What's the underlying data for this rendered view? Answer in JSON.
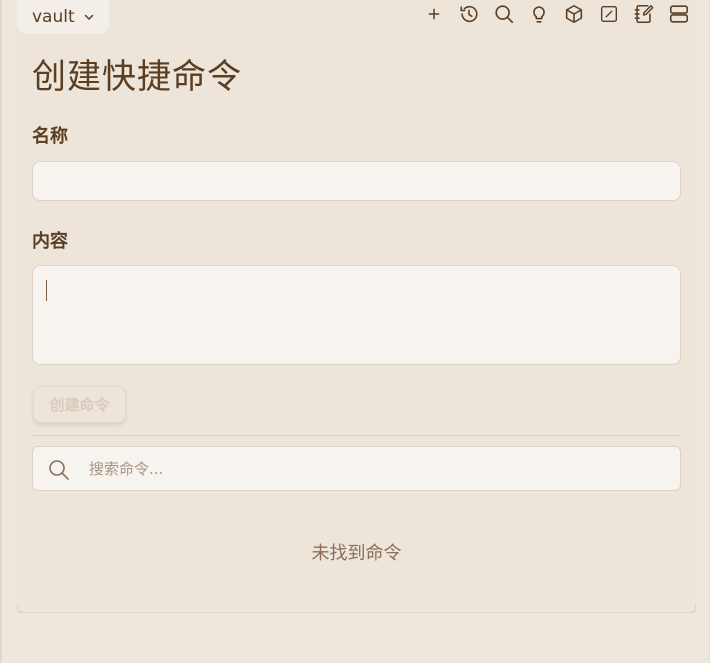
{
  "vault": {
    "label": "vault"
  },
  "toolbar": {
    "icons": [
      "plus-icon",
      "history-icon",
      "search-icon",
      "lightbulb-icon",
      "cube-icon",
      "edit-square-icon",
      "notebook-edit-icon",
      "server-icon"
    ]
  },
  "page": {
    "title": "创建快捷命令"
  },
  "form": {
    "name_label": "名称",
    "name_value": "",
    "content_label": "内容",
    "content_value": "",
    "create_button": "创建命令"
  },
  "search": {
    "placeholder": "搜索命令..."
  },
  "list": {
    "empty_text": "未找到命令"
  },
  "colors": {
    "background": "#efe6dd",
    "text": "#5a3e22",
    "input_bg": "#f7f3ee",
    "disabled_text": "#d9cbbd"
  }
}
